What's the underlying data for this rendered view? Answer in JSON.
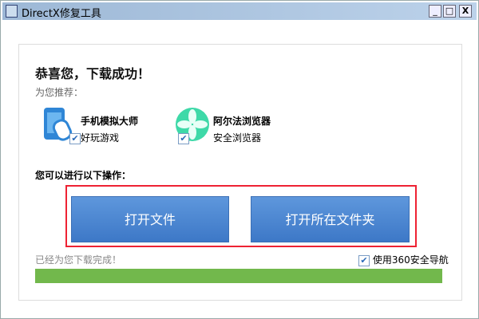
{
  "window": {
    "title": "DirectX修复工具",
    "min": "_",
    "max": "□",
    "close": "X"
  },
  "heading": "恭喜您，下载成功！",
  "recommend_label": "为您推荐：",
  "apps": [
    {
      "name": "手机模拟大师",
      "desc": "好玩游戏",
      "checked": true
    },
    {
      "name": "阿尔法浏览器",
      "desc": "安全浏览器",
      "checked": true
    }
  ],
  "ops_label": "您可以进行以下操作：",
  "buttons": {
    "open_file": "打开文件",
    "open_folder": "打开所在文件夹"
  },
  "status": "已经为您下载完成！",
  "nav_option": {
    "label": "使用360安全导航",
    "checked": true
  },
  "progress": 1.0,
  "colors": {
    "accent": "#4a86d0",
    "progress": "#72b84c",
    "highlight": "#e23333"
  }
}
